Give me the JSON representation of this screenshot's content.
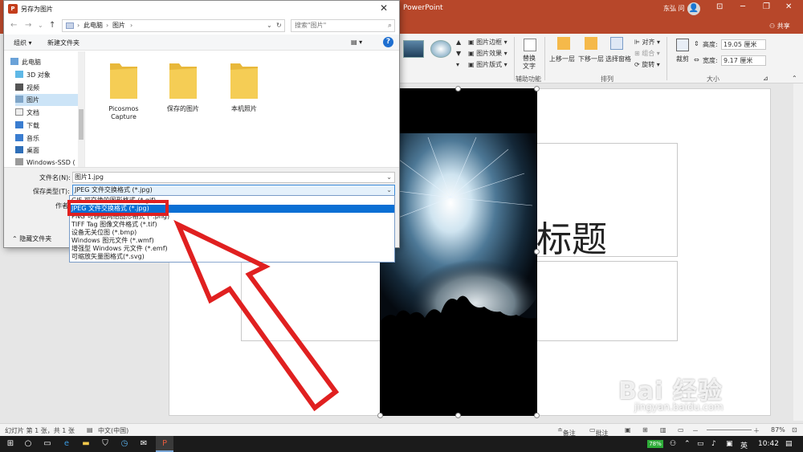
{
  "ppt": {
    "app_title": "PowerPoint",
    "user_name": "东弘 问",
    "share_label": "共享",
    "ribbon": {
      "picture_border": "图片边框",
      "picture_effects": "图片效果",
      "picture_layout": "图片版式",
      "alt_text_1": "替换",
      "alt_text_2": "文字",
      "bring_forward": "上移一层",
      "send_backward": "下移一层",
      "selection_pane": "选择窗格",
      "align": "对齐",
      "group": "组合",
      "rotate": "旋转",
      "crop": "裁剪",
      "height_label": "高度:",
      "height_value": "19.05 厘米",
      "width_label": "宽度:",
      "width_value": "9.17 厘米",
      "group_accessibility": "辅助功能",
      "group_arrange": "排列",
      "group_size": "大小"
    },
    "slide": {
      "title_text": "标题"
    },
    "status": {
      "slide_info": "幻灯片 第 1 张，共 1 张",
      "language": "中文(中国)",
      "notes": "备注",
      "comments": "批注",
      "zoom": "87%"
    },
    "taskbar": {
      "battery": "78%",
      "ime": "英",
      "time": "10:42"
    }
  },
  "dialog": {
    "title": "另存为图片",
    "breadcrumb": [
      "此电脑",
      "图片"
    ],
    "search_placeholder": "搜索\"图片\"",
    "toolbar": {
      "organize": "组织 ▾",
      "new_folder": "新建文件夹"
    },
    "nav_items": [
      {
        "label": "此电脑",
        "icon": "pc-icon"
      },
      {
        "label": "3D 对象",
        "icon": "cube-icon"
      },
      {
        "label": "视频",
        "icon": "video-icon"
      },
      {
        "label": "图片",
        "icon": "pictures-icon"
      },
      {
        "label": "文档",
        "icon": "document-icon"
      },
      {
        "label": "下载",
        "icon": "download-icon"
      },
      {
        "label": "音乐",
        "icon": "music-icon"
      },
      {
        "label": "桌面",
        "icon": "desktop-icon"
      },
      {
        "label": "Windows-SSD (",
        "icon": "drive-icon"
      }
    ],
    "folders": [
      {
        "name_line1": "Picosmos",
        "name_line2": "Capture"
      },
      {
        "name_line1": "保存的图片",
        "name_line2": ""
      },
      {
        "name_line1": "本机照片",
        "name_line2": ""
      }
    ],
    "filename_label": "文件名(N):",
    "filename_value": "图片1.jpg",
    "filetype_label": "保存类型(T):",
    "filetype_value": "JPEG 文件交换格式 (*.jpg)",
    "author_label": "作者",
    "hide_folders": "隐藏文件夹",
    "dropdown_options": [
      "GIF 可交换的图形格式 (*.gif)",
      "JPEG 文件交换格式 (*.jpg)",
      "PNG 可移植网络图形格式 (*.png)",
      "TIFF Tag 图像文件格式 (*.tif)",
      "设备无关位图 (*.bmp)",
      "Windows 图元文件 (*.wmf)",
      "增强型 Windows 元文件 (*.emf)",
      "可缩放矢量图格式(*.svg)"
    ],
    "dropdown_selected_index": 1
  },
  "watermark": {
    "brand": "Bai  经验",
    "url": "jingyan.baidu.com"
  },
  "colors": {
    "ppt_accent": "#b7472a",
    "highlight_red": "#e02020",
    "selection_blue": "#0a6fd4",
    "folder_yellow": "#f5cd55"
  }
}
